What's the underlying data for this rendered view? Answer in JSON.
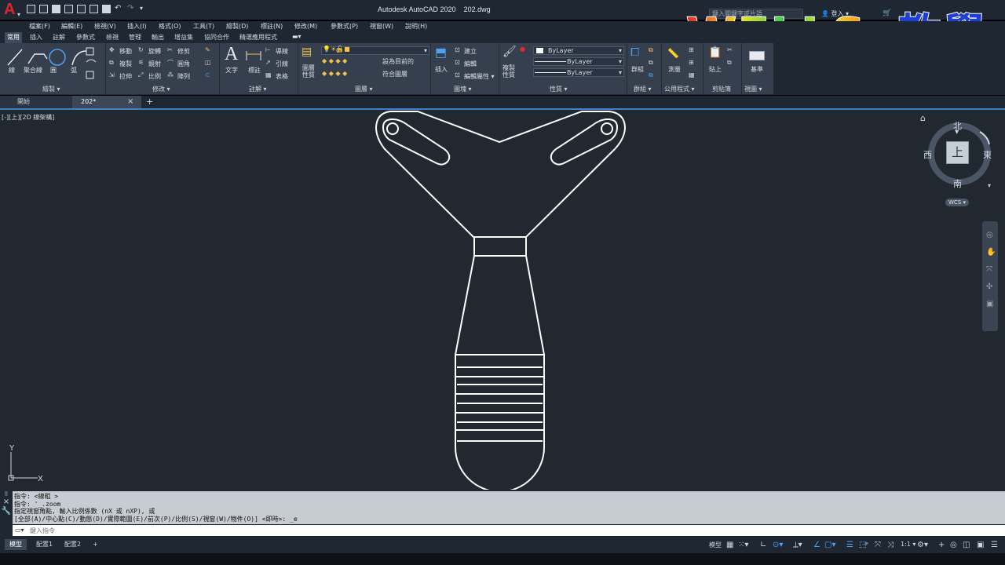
{
  "window": {
    "title": "Autodesk AutoCAD 2020    202.dwg",
    "search_placeholder": "鍵入關鍵字或片語",
    "login_label": "登入"
  },
  "menu": [
    "檔案(F)",
    "編輯(E)",
    "檢視(V)",
    "插入(I)",
    "格式(O)",
    "工具(T)",
    "繪製(D)",
    "標註(N)",
    "修改(M)",
    "參數式(P)",
    "視窗(W)",
    "說明(H)"
  ],
  "ribbon_tabs": [
    "常用",
    "插入",
    "註解",
    "參數式",
    "檢視",
    "管理",
    "輸出",
    "增益集",
    "協同合作",
    "精選應用程式"
  ],
  "ribbon": {
    "draw": {
      "title": "繪製 ▾",
      "line": "線",
      "polyline": "聚合線",
      "circle": "圓",
      "arc": "弧"
    },
    "modify": {
      "title": "修改 ▾",
      "move": "移動",
      "rotate": "旋轉",
      "trim": "修剪",
      "copy": "複製",
      "mirror": "鏡射",
      "fillet": "圓角",
      "stretch": "拉伸",
      "scale": "比例",
      "array": "陣列"
    },
    "annotation": {
      "title": "註解 ▾",
      "text": "文字",
      "dimension": "標註",
      "leader": "導線",
      "multileader": "引線",
      "table": "表格"
    },
    "layers": {
      "title": "圖層 ▾",
      "properties": "圖層\n性質",
      "current_layer": "0",
      "make_current": "設為目前的",
      "match_layer": "符合圖層"
    },
    "block": {
      "title": "圖塊 ▾",
      "insert": "插入",
      "create": "建立",
      "edit": "編輯",
      "edit_attributes": "編輯屬性 ▾"
    },
    "properties": {
      "title": "性質 ▾",
      "match": "複製\n性質",
      "color": "ByLayer",
      "linetype": "ByLayer",
      "lineweight": "ByLayer"
    },
    "groups": {
      "title": "群組 ▾",
      "group": "群組"
    },
    "utilities": {
      "title": "公用程式 ▾",
      "measure": "測量"
    },
    "clipboard": {
      "title": "剪貼簿",
      "paste": "貼上"
    },
    "view": {
      "title": "視圖 ▾",
      "base": "基準"
    }
  },
  "file_tabs": {
    "start": "開始",
    "current": "202*"
  },
  "viewport": {
    "label": "[-][上][2D 線架構]"
  },
  "viewcube": {
    "north": "北",
    "south": "南",
    "east": "東",
    "west": "西",
    "face": "上",
    "wcs": "WCS ▾"
  },
  "ucs": {
    "x": "X",
    "y": "Y"
  },
  "command": {
    "history": [
      "指令: <線粗 >",
      "指令: '_.zoom",
      "指定視窗角點, 輸入比例係數 (nX 或 nXP), 或",
      "[全部(A)/中心點(C)/動態(D)/實際範圍(E)/前次(P)/比例(S)/視窗(W)/物件(O)] <即時>: _e"
    ],
    "input_placeholder": "鍵入指令"
  },
  "layout_tabs": [
    "模型",
    "配置1",
    "配置2",
    "+"
  ],
  "status": {
    "model": "模型",
    "scale": "1:1 ▾"
  },
  "watermark": {
    "latin": "WELLS",
    "cjk": "教學"
  }
}
